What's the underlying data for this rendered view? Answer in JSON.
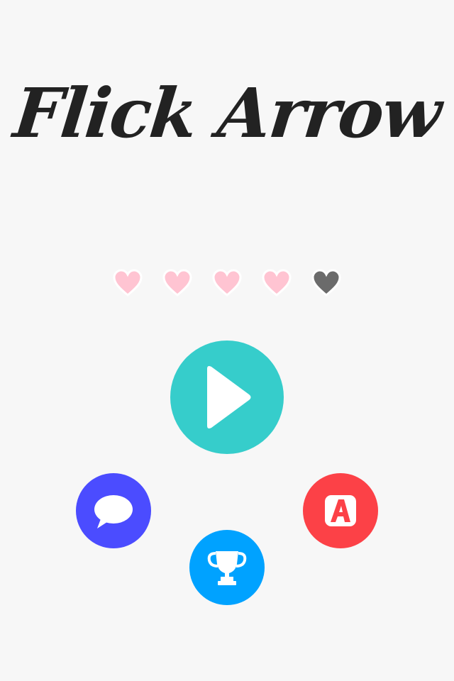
{
  "title": "Flick Arrow",
  "lives": {
    "total": 5,
    "filled": 4,
    "filled_color": "#ffc4d2",
    "empty_color": "#6b6b6b"
  },
  "buttons": {
    "play": {
      "icon": "play-icon",
      "color": "#36cdcb"
    },
    "chat": {
      "icon": "speech-bubble-icon",
      "color": "#4b4cff"
    },
    "leaderboard": {
      "icon": "trophy-icon",
      "color": "#00a2ff"
    },
    "app": {
      "icon": "app-store-a-icon",
      "color": "#fc4147"
    }
  },
  "background_color": "#f7f7f7"
}
